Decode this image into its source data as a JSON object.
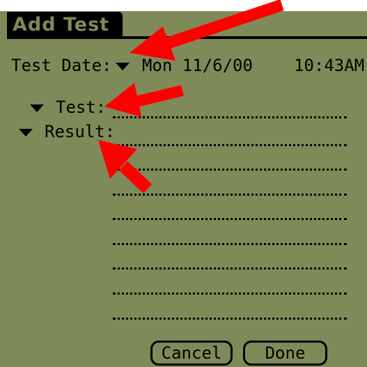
{
  "window": {
    "title": "Add Test"
  },
  "fields": {
    "test_date_label": "Test Date:",
    "date": "Mon 11/6/00",
    "time": "10:43AM",
    "test_label": "Test:",
    "result_label": "Result:"
  },
  "buttons": {
    "cancel": "Cancel",
    "done": "Done"
  },
  "icons": {
    "dropdown": "triangle-down-icon",
    "annotation": "red-arrow-icon"
  },
  "colors": {
    "screen_bg": "#7f8a59",
    "text": "#000000",
    "arrow": "#ff0000"
  }
}
